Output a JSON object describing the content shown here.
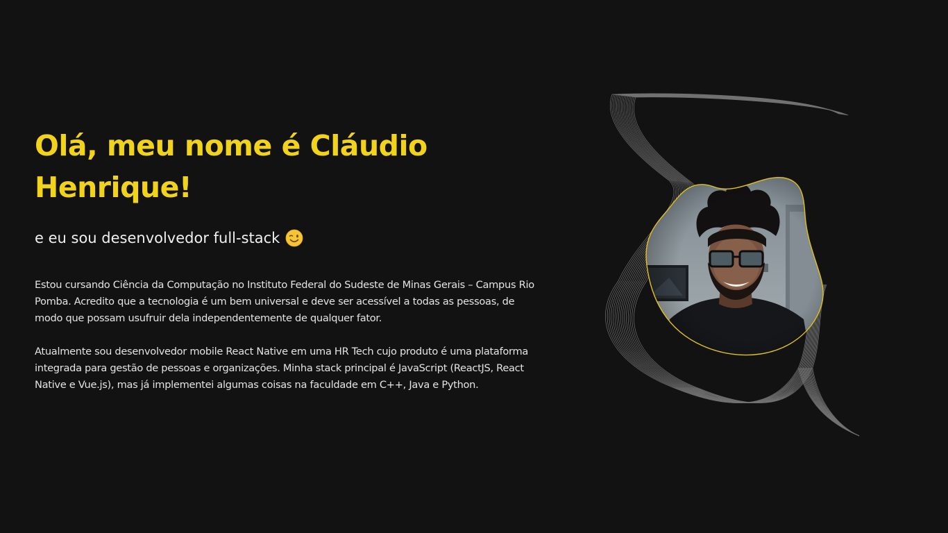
{
  "hero": {
    "headline_line1": "Olá, meu nome é Cláudio",
    "headline_line2": "Henrique!",
    "subtitle": "e eu sou desenvolvedor full-stack",
    "subtitle_icon": "winking-face-icon",
    "paragraphs": [
      "Estou cursando Ciência da Computação no Instituto Federal do Sudeste de Minas Gerais – Campus Rio Pomba. Acredito que a tecnologia é um bem universal e deve ser acessível a todas as pessoas, de modo que possam usufruir dela independentemente de qualquer fator.",
      "Atualmente sou desenvolvedor mobile React Native em uma HR Tech cujo produto é uma plataforma integrada para gestão de pessoas e organizações. Minha stack principal é JavaScript (ReactJS, React Native e Vue.js), mas já implementei algumas coisas na faculdade em C++, Java e Python."
    ]
  },
  "profile": {
    "photo_icon": "profile-photo",
    "background_icon": "wave-lines-icon"
  },
  "colors": {
    "background": "#121212",
    "accent": "#f2d31c",
    "text": "#e6e6e6"
  }
}
